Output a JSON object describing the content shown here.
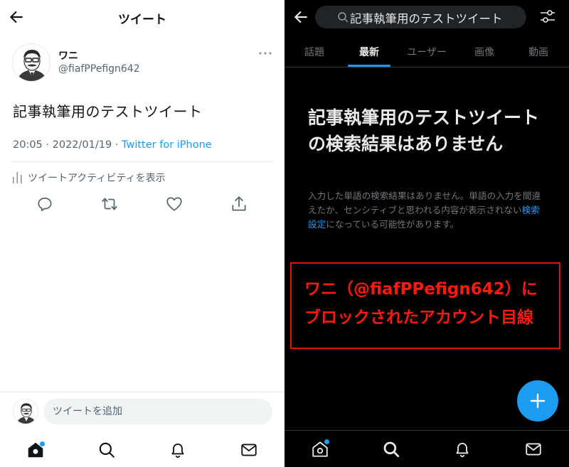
{
  "left": {
    "header": {
      "title": "ツイート"
    },
    "tweet": {
      "name": "ワニ",
      "handle": "@fiafPPefign642",
      "text": "記事執筆用のテストツイート",
      "time": "20:05 · 2022/01/19 · ",
      "via": "Twitter for iPhone",
      "activity": "ツイートアクティビティを表示"
    },
    "compose": {
      "placeholder": "ツイートを追加"
    }
  },
  "right": {
    "search": {
      "query": "記事執筆用のテストツイート"
    },
    "tabs": [
      "話題",
      "最新",
      "ユーザー",
      "画像",
      "動画"
    ],
    "active_tab": "最新",
    "empty": {
      "title": "記事執筆用のテストツイートの検索結果はありません",
      "body_before": "入力した単語の検索結果はありません。単語の入力を間違えたか、センシティブと思われる内容が表示されない",
      "body_link": "検索設定",
      "body_after": "になっている可能性があります。"
    },
    "annotation": {
      "line1": "ワニ（@fiafPPefign642）に",
      "line2": "ブロックされたアカウント目線"
    }
  },
  "colors": {
    "accent": "#1d9bf0",
    "annotation_red": "#ff1a0d",
    "dark_bg": "#000000"
  }
}
